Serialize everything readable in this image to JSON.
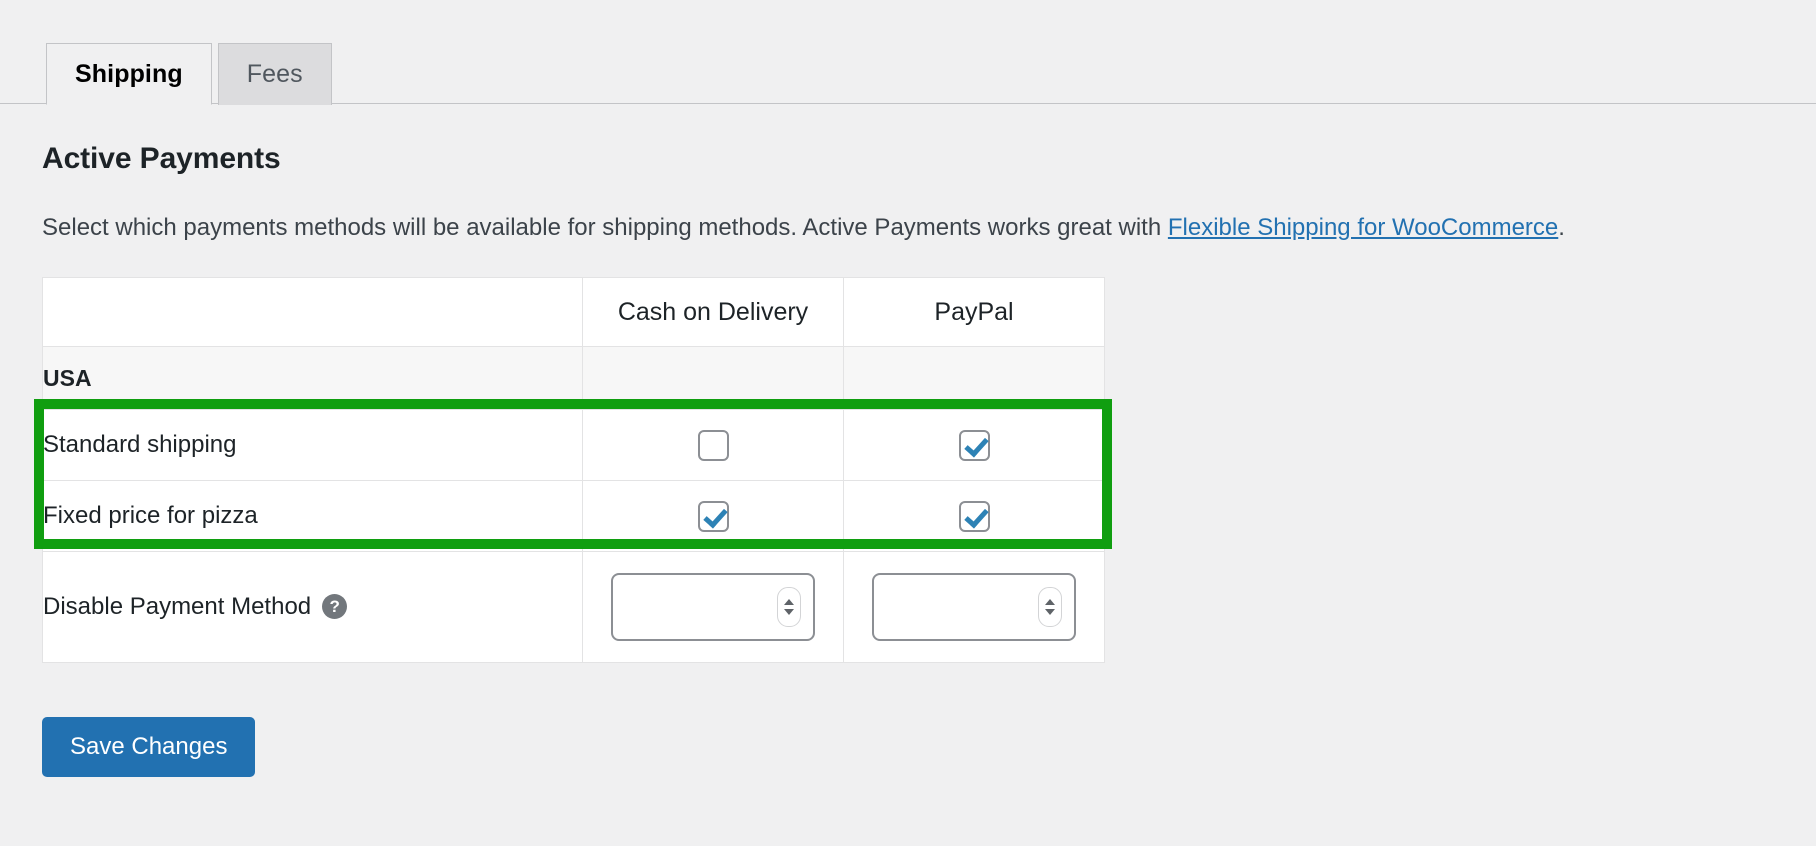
{
  "tabs": [
    {
      "label": "Shipping",
      "active": true
    },
    {
      "label": "Fees",
      "active": false
    }
  ],
  "section": {
    "title": "Active Payments",
    "description_before": "Select which payments methods will be available for shipping methods. Active Payments works great with ",
    "link_text": "Flexible Shipping for WooCommerce",
    "description_after": "."
  },
  "table": {
    "blank_header": "",
    "columns": [
      "Cash on Delivery",
      "PayPal"
    ],
    "group": {
      "label": "USA"
    },
    "rows": [
      {
        "label": "Standard shipping",
        "checks": [
          false,
          true
        ]
      },
      {
        "label": "Fixed price for pizza",
        "checks": [
          true,
          true
        ]
      }
    ],
    "disable_row": {
      "label": "Disable Payment Method",
      "help_icon": "help-circle-icon",
      "help_glyph": "?",
      "inputs": [
        {
          "value": "",
          "placeholder": ""
        },
        {
          "value": "",
          "placeholder": ""
        }
      ]
    }
  },
  "footer": {
    "save_label": "Save Changes"
  },
  "colors": {
    "accent": "#2271b1",
    "highlight": "#109e10",
    "checkmark": "#2d82b5",
    "page_bg": "#f0f0f1"
  }
}
